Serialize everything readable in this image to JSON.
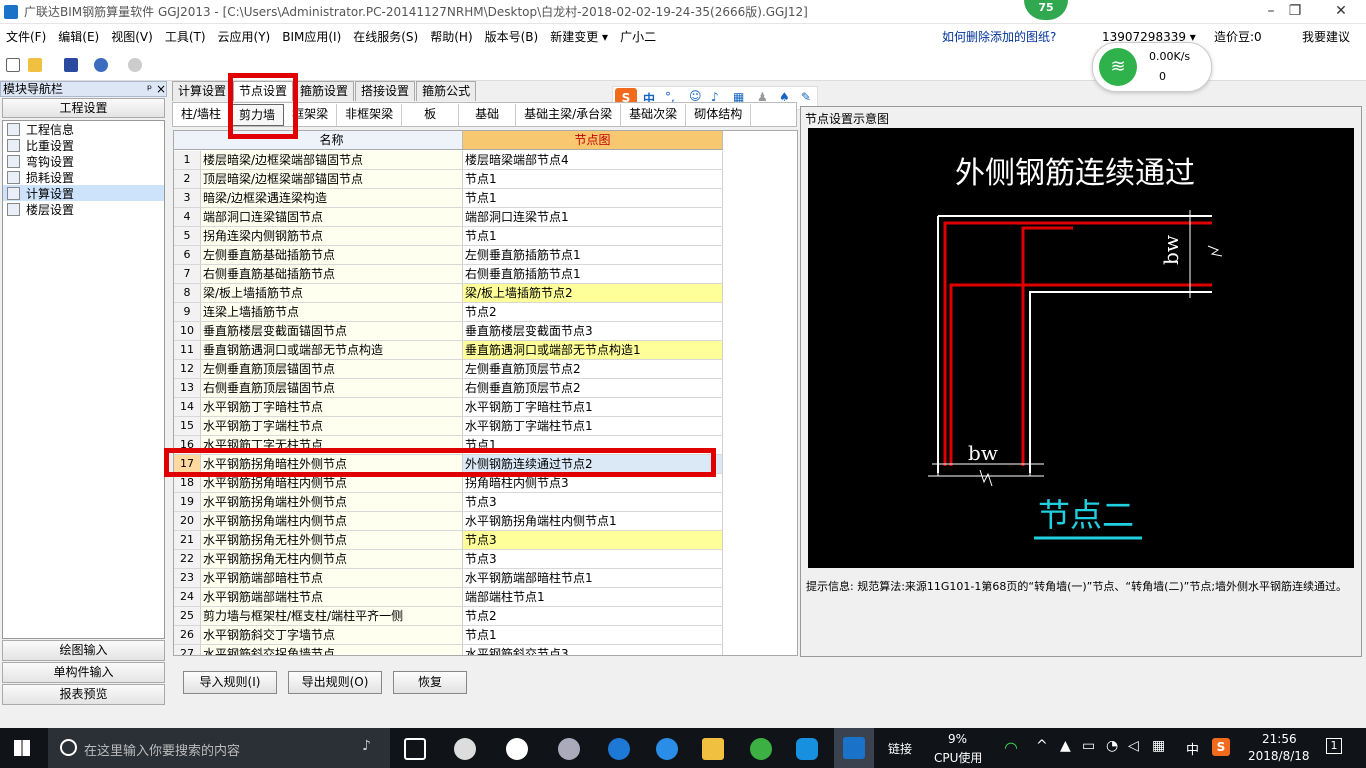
{
  "window": {
    "title": "广联达BIM钢筋算量软件 GGJ2013 - [C:\\Users\\Administrator.PC-20141127NRHM\\Desktop\\白龙村-2018-02-02-19-24-35(2666版).GGJ12]",
    "badge": "75",
    "min": "–",
    "max": "❐",
    "close": "✕"
  },
  "menu": [
    "文件(F)",
    "编辑(E)",
    "视图(V)",
    "工具(T)",
    "云应用(Y)",
    "BIM应用(I)",
    "在线服务(S)",
    "帮助(H)",
    "版本号(B)",
    "新建变更 ▾",
    "广小二"
  ],
  "help_link": "如何删除添加的图纸?",
  "phone": "13907298339 ▾",
  "coin": "造价豆:0",
  "suggest": "我要建议",
  "net": {
    "speed": "0.00K/s",
    "count": "0"
  },
  "left": {
    "title": "模块导航栏",
    "pin": "ᵖ ×",
    "section": "工程设置",
    "tree": [
      "工程信息",
      "比重设置",
      "弯钩设置",
      "损耗设置",
      "计算设置",
      "楼层设置"
    ],
    "bottom": [
      "绘图输入",
      "单构件输入",
      "报表预览"
    ]
  },
  "tabs1": [
    "计算设置",
    "节点设置",
    "箍筋设置",
    "搭接设置",
    "箍筋公式"
  ],
  "tabs2": [
    "柱/墙柱",
    "剪力墙",
    "框架梁",
    "非框架梁",
    "板",
    "基础",
    "基础主梁/承台梁",
    "基础次梁",
    "砌体结构"
  ],
  "grid": {
    "col_name": "名称",
    "col_node": "节点图",
    "rows": [
      [
        "1",
        "楼层暗梁/边框梁端部锚固节点",
        "楼层暗梁端部节点4",
        false
      ],
      [
        "2",
        "顶层暗梁/边框梁端部锚固节点",
        "节点1",
        false
      ],
      [
        "3",
        "暗梁/边框梁遇连梁构造",
        "节点1",
        false
      ],
      [
        "4",
        "端部洞口连梁锚固节点",
        "端部洞口连梁节点1",
        false
      ],
      [
        "5",
        "拐角连梁内侧钢筋节点",
        "节点1",
        false
      ],
      [
        "6",
        "左侧垂直筋基础插筋节点",
        "左侧垂直筋插筋节点1",
        false
      ],
      [
        "7",
        "右侧垂直筋基础插筋节点",
        "右侧垂直筋插筋节点1",
        false
      ],
      [
        "8",
        "梁/板上墙插筋节点",
        "梁/板上墙插筋节点2",
        true
      ],
      [
        "9",
        "连梁上墙插筋节点",
        "节点2",
        false
      ],
      [
        "10",
        "垂直筋楼层变截面锚固节点",
        "垂直筋楼层变截面节点3",
        false
      ],
      [
        "11",
        "垂直钢筋遇洞口或端部无节点构造",
        "垂直筋遇洞口或端部无节点构造1",
        true
      ],
      [
        "12",
        "左侧垂直筋顶层锚固节点",
        "左侧垂直筋顶层节点2",
        false
      ],
      [
        "13",
        "右侧垂直筋顶层锚固节点",
        "右侧垂直筋顶层节点2",
        false
      ],
      [
        "14",
        "水平钢筋丁字暗柱节点",
        "水平钢筋丁字暗柱节点1",
        false
      ],
      [
        "15",
        "水平钢筋丁字端柱节点",
        "水平钢筋丁字端柱节点1",
        false
      ],
      [
        "16",
        "水平钢筋丁字无柱节点",
        "节点1",
        false
      ],
      [
        "17",
        "水平钢筋拐角暗柱外侧节点",
        "外侧钢筋连续通过节点2",
        false
      ],
      [
        "18",
        "水平钢筋拐角暗柱内侧节点",
        "拐角暗柱内侧节点3",
        false
      ],
      [
        "19",
        "水平钢筋拐角端柱外侧节点",
        "节点3",
        false
      ],
      [
        "20",
        "水平钢筋拐角端柱内侧节点",
        "水平钢筋拐角端柱内侧节点1",
        false
      ],
      [
        "21",
        "水平钢筋拐角无柱外侧节点",
        "节点3",
        true
      ],
      [
        "22",
        "水平钢筋拐角无柱内侧节点",
        "节点3",
        false
      ],
      [
        "23",
        "水平钢筋端部暗柱节点",
        "水平钢筋端部暗柱节点1",
        false
      ],
      [
        "24",
        "水平钢筋端部端柱节点",
        "端部端柱节点1",
        false
      ],
      [
        "25",
        "剪力墙与框架柱/框支柱/端柱平齐一侧",
        "节点2",
        false
      ],
      [
        "26",
        "水平钢筋斜交丁字墙节点",
        "节点1",
        false
      ],
      [
        "27",
        "水平钢筋斜交拐角墙节点",
        "水平钢筋斜交节点3",
        false
      ]
    ]
  },
  "right": {
    "title": "节点设置示意图",
    "diagram_title": "外侧钢筋连续通过",
    "bw": "bw",
    "caption": "节点二",
    "hint": "提示信息: 规范算法:来源11G101-1第68页的“转角墙(一)”节点、“转角墙(二)”节点;墙外侧水平钢筋连续通过。"
  },
  "buttons": [
    "导入规则(I)",
    "导出规则(O)",
    "恢复"
  ],
  "taskbar": {
    "search": "在这里输入你要搜索的内容",
    "link": "链接",
    "cpu_pct": "9%",
    "cpu": "CPU使用",
    "lang": "中",
    "time": "21:56",
    "date": "2018/8/18",
    "notif": "1"
  }
}
